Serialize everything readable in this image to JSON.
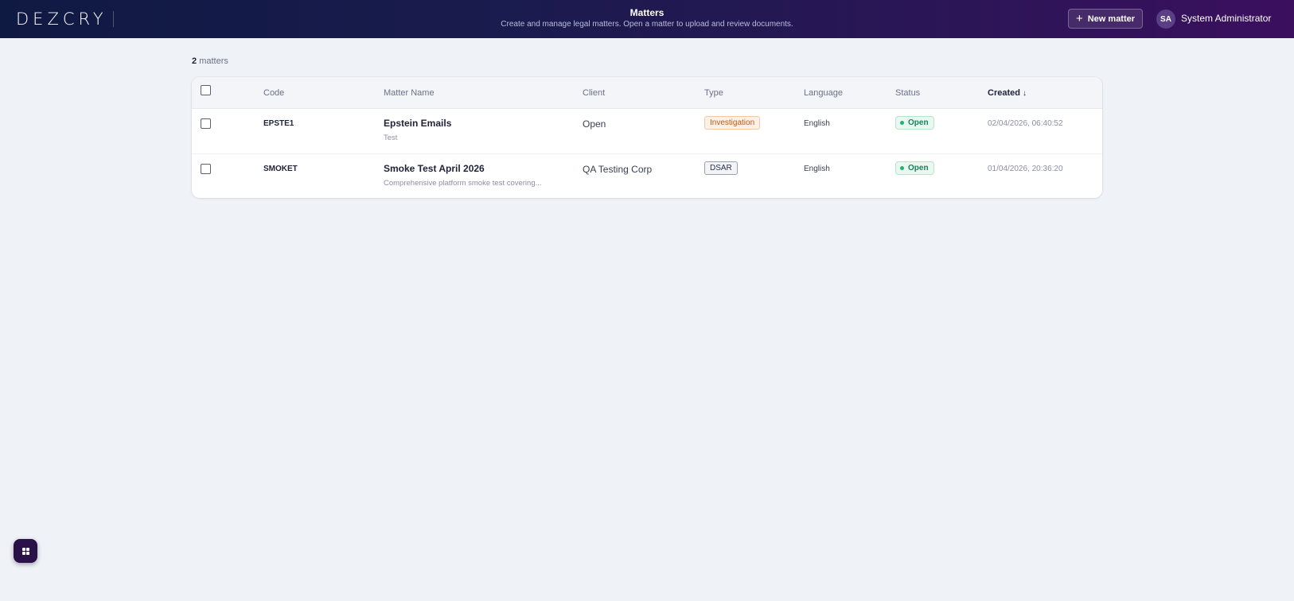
{
  "header": {
    "logo": "DEZCRY",
    "title": "Matters",
    "subtitle": "Create and manage legal matters. Open a matter to upload and review documents.",
    "new_matter_label": "New matter",
    "user_initials": "SA",
    "user_name": "System Administrator"
  },
  "summary": {
    "count": "2",
    "label": "matters"
  },
  "table": {
    "columns": {
      "code": "Code",
      "name": "Matter Name",
      "client": "Client",
      "type": "Type",
      "language": "Language",
      "status": "Status",
      "created": "Created"
    },
    "sort_icon": "↓",
    "rows": [
      {
        "code": "EPSTE1",
        "name": "Epstein Emails",
        "description": "Test",
        "client": "Open",
        "type": "Investigation",
        "language": "English",
        "status": "Open",
        "created": "02/04/2026, 06:40:52"
      },
      {
        "code": "SMOKET",
        "name": "Smoke Test April 2026",
        "description": "Comprehensive platform smoke test covering...",
        "client": "QA Testing Corp",
        "type": "DSAR",
        "language": "English",
        "status": "Open",
        "created": "01/04/2026, 20:36:20"
      }
    ]
  },
  "colors": {
    "header_gradient_start": "#0f1a42",
    "header_gradient_end": "#3b0f5e",
    "page_background": "#eff2f7",
    "status_open": "#16855a",
    "type_investigation": "#b45a1f"
  },
  "icons": {
    "new_matter": "plus-icon",
    "launcher": "grid-icon"
  }
}
